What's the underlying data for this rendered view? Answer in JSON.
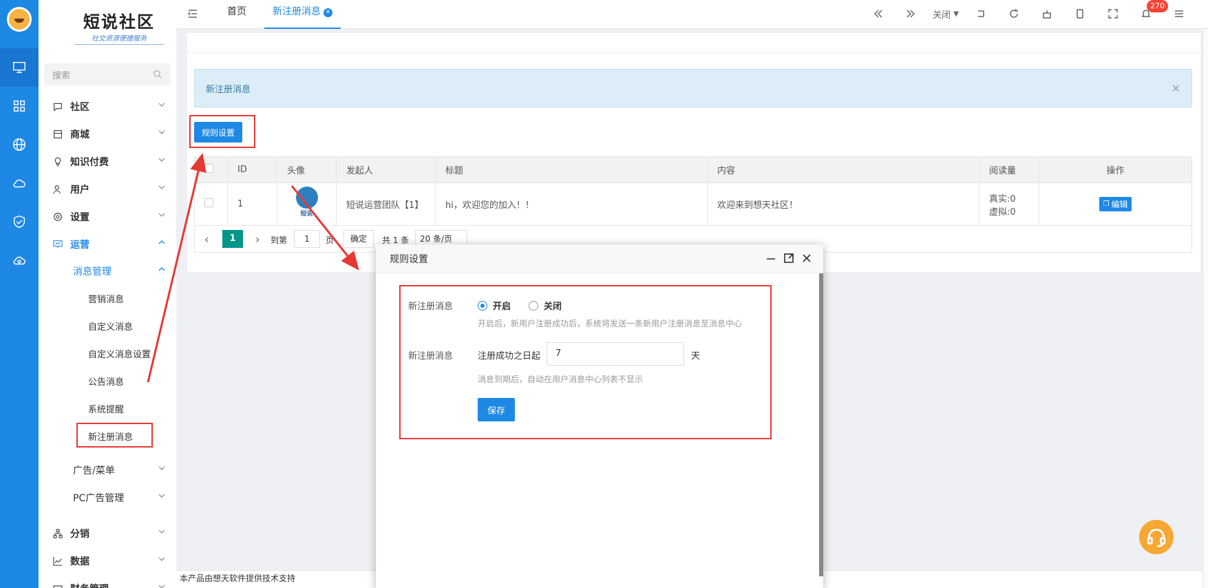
{
  "brand": {
    "title": "短说社区",
    "slogan": "社交资源便捷服务"
  },
  "sidebar": {
    "search_placeholder": "搜索",
    "menu": [
      {
        "label": "社区",
        "icon": "chat-icon"
      },
      {
        "label": "商城",
        "icon": "store-icon"
      },
      {
        "label": "知识付费",
        "icon": "bulb-icon"
      },
      {
        "label": "用户",
        "icon": "user-icon"
      },
      {
        "label": "设置",
        "icon": "gear-icon"
      },
      {
        "label": "运营",
        "icon": "presentation-icon"
      },
      {
        "label": "消息管理"
      },
      {
        "label": "营销消息"
      },
      {
        "label": "自定义消息"
      },
      {
        "label": "自定义消息设置"
      },
      {
        "label": "公告消息"
      },
      {
        "label": "系统提醒"
      },
      {
        "label": "新注册消息"
      },
      {
        "label": "广告/菜单"
      },
      {
        "label": "PC广告管理"
      },
      {
        "label": "分销",
        "icon": "network-icon"
      },
      {
        "label": "数据",
        "icon": "chart-icon"
      },
      {
        "label": "财务管理",
        "icon": "wallet-icon"
      }
    ]
  },
  "topbar": {
    "tabs": [
      {
        "label": "首页"
      },
      {
        "label": "新注册消息"
      }
    ],
    "close_label": "关闭",
    "notification_count": "270"
  },
  "content": {
    "alert_text": "新注册消息",
    "rule_button": "规则设置",
    "table": {
      "headers": [
        "ID",
        "头像",
        "发起人",
        "标题",
        "内容",
        "阅读量",
        "操作"
      ],
      "rows": [
        {
          "id": "1",
          "avatar_text": "短说",
          "sender": "短说运营团队【1】",
          "title": "hi，欢迎您的加入！！",
          "content": "欢迎来到想天社区！",
          "reads_real": "真实:0",
          "reads_virtual": "虚拟:0",
          "action": "编辑"
        }
      ]
    },
    "pager": {
      "current": "1",
      "goto_label": "到第",
      "goto_value": "1",
      "page_unit": "页",
      "confirm": "确定",
      "total": "共 1 条",
      "page_size": "20 条/页"
    }
  },
  "footer": {
    "text": "本产品由想天软件提供技术支持"
  },
  "modal": {
    "title": "规则设置",
    "row1_label": "新注册消息",
    "radio_on": "开启",
    "radio_off": "关闭",
    "row1_hint": "开启后，新用户注册成功后，系统将发送一条新用户注册消息至消息中心",
    "row2_label": "新注册消息",
    "days_prefix": "注册成功之日起",
    "days_value": "7",
    "days_unit": "天",
    "row2_hint": "消息到期后，自动在用户消息中心列表不显示",
    "save": "保存"
  },
  "colors": {
    "primary": "#1e88e5",
    "annotation": "#e53935",
    "pager_active": "#009688",
    "support": "#f7a733"
  }
}
